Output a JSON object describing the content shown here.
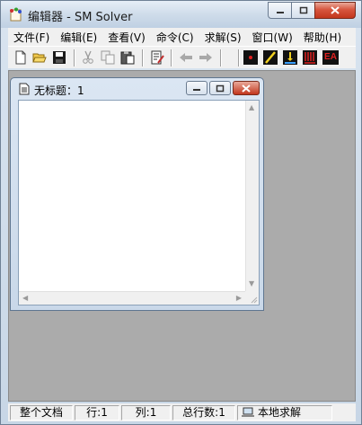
{
  "window": {
    "title": "编辑器 - SM Solver"
  },
  "menu": [
    "文件(F)",
    "编辑(E)",
    "查看(V)",
    "命令(C)",
    "求解(S)",
    "窗口(W)",
    "帮助(H)"
  ],
  "toolbar": {
    "icons": [
      "new-file-icon",
      "open-folder-icon",
      "save-icon",
      "cut-icon",
      "copy-icon",
      "paste-icon",
      "edit-document-icon",
      "back-arrow-icon",
      "forward-arrow-icon",
      "run-point-icon",
      "run-line-icon",
      "run-diagram-icon",
      "run-bars-icon",
      "ea-icon"
    ],
    "ea_label": "EA"
  },
  "child": {
    "title": "无标题：1"
  },
  "status": {
    "scope": "整个文档",
    "row": "行:1",
    "col": "列:1",
    "total": "总行数:1",
    "mode": "本地求解"
  }
}
